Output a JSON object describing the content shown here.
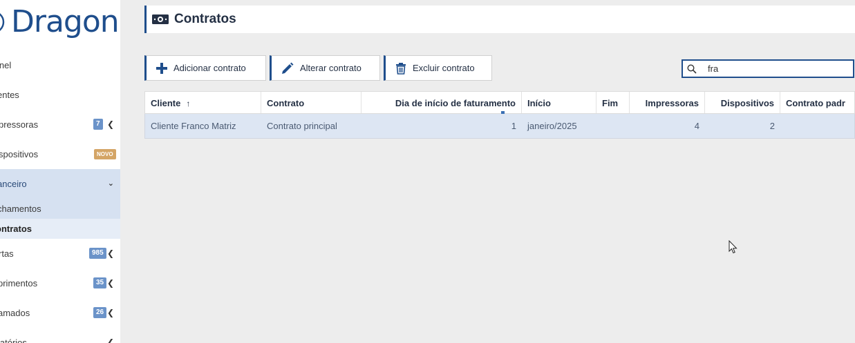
{
  "brand": {
    "name": "Dragon",
    "color": "#1f4e8c"
  },
  "sidebar": {
    "items": [
      {
        "label": "inel",
        "badge": null
      },
      {
        "label": "entes",
        "badge": null
      },
      {
        "label": "pressoras",
        "badge": "7"
      },
      {
        "label": "spositivos",
        "badge": "NOVO"
      },
      {
        "label": "anceiro",
        "badge": null,
        "expanded": true
      },
      {
        "label": "chamentos"
      },
      {
        "label": "ontratos"
      },
      {
        "label": "rtas",
        "badge": "985"
      },
      {
        "label": "primentos",
        "badge": "35"
      },
      {
        "label": "amados",
        "badge": "26"
      },
      {
        "label": "latórios"
      }
    ]
  },
  "header": {
    "title": "Contratos",
    "icon": "money-icon"
  },
  "toolbar": {
    "add_label": "Adicionar contrato",
    "edit_label": "Alterar contrato",
    "delete_label": "Excluir contrato"
  },
  "search": {
    "value": "fra",
    "icon": "search-icon"
  },
  "table": {
    "columns": [
      "Cliente",
      "Contrato",
      "Dia de início de faturamento",
      "Início",
      "Fim",
      "Impressoras",
      "Dispositivos",
      "Contrato padr"
    ],
    "sort_indicator": "↑",
    "rows": [
      {
        "cliente": "Cliente Franco Matriz",
        "contrato": "Contrato principal",
        "dia": "1",
        "inicio": "janeiro/2025",
        "fim": "",
        "impressoras": "4",
        "dispositivos": "2",
        "padrao": ""
      }
    ]
  },
  "colors": {
    "accent": "#1f4e8c",
    "selected_row": "#dde6f3",
    "badge": "#6b93c9",
    "badge_new": "#d4a566"
  }
}
